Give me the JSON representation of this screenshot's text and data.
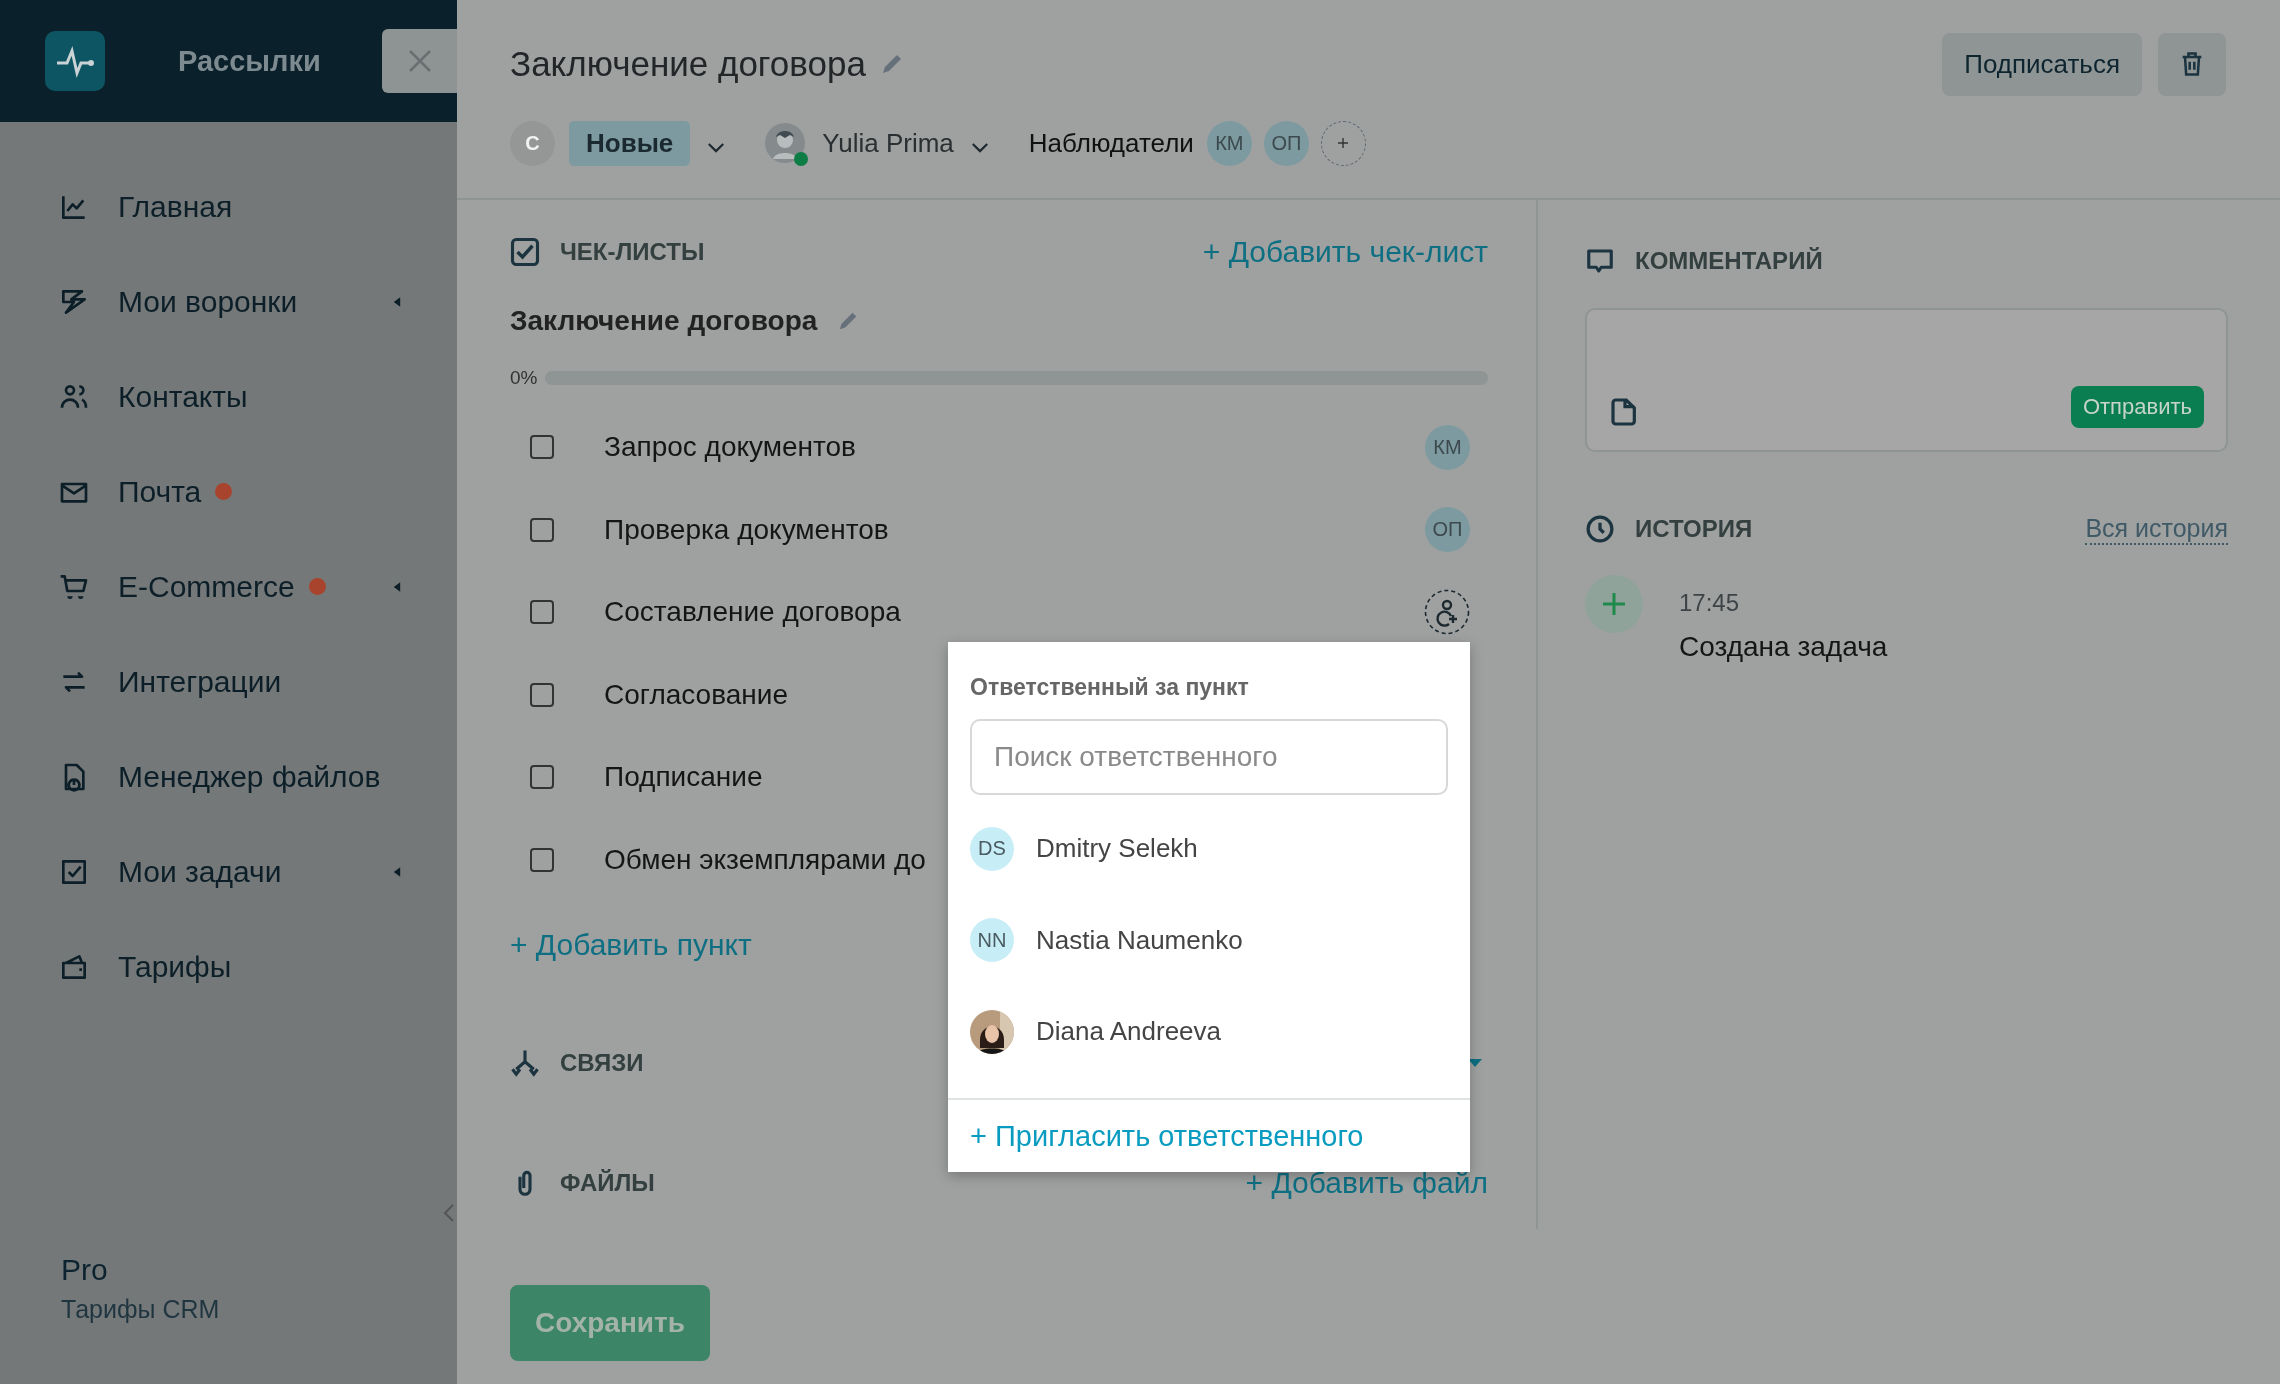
{
  "sidebar": {
    "brand": "Рассылки",
    "items": [
      {
        "label": "Главная",
        "has_badge": false,
        "expandable": false
      },
      {
        "label": "Мои воронки",
        "has_badge": false,
        "expandable": true
      },
      {
        "label": "Контакты",
        "has_badge": false,
        "expandable": false
      },
      {
        "label": "Почта",
        "has_badge": true,
        "expandable": false
      },
      {
        "label": "E-Commerce",
        "has_badge": true,
        "expandable": true
      },
      {
        "label": "Интеграции",
        "has_badge": false,
        "expandable": false
      },
      {
        "label": "Менеджер файлов",
        "has_badge": false,
        "expandable": false
      },
      {
        "label": "Мои задачи",
        "has_badge": false,
        "expandable": true
      },
      {
        "label": "Тарифы",
        "has_badge": false,
        "expandable": false
      }
    ],
    "plan": {
      "name": "Pro",
      "subtitle": "Тарифы CRM"
    }
  },
  "task": {
    "title": "Заключение договора",
    "subscribe": "Подписаться",
    "status": {
      "avatar": "С",
      "label": "Новые"
    },
    "assignee": {
      "name": "Yulia Prima",
      "online": true
    },
    "watchers": {
      "label": "Наблюдатели",
      "avatars": [
        "КМ",
        "ОП"
      ]
    }
  },
  "checklists": {
    "heading": "ЧЕК-ЛИСТЫ",
    "add": "+ Добавить чек-лист",
    "name": "Заключение договора",
    "progress": "0%",
    "level": 0,
    "items": [
      {
        "text": "Запрос документов",
        "checked": false,
        "assignee": "КМ",
        "picker_open": false
      },
      {
        "text": "Проверка документов",
        "checked": false,
        "assignee": "ОП",
        "picker_open": false
      },
      {
        "text": "Составление договора",
        "checked": false,
        "picker_open": true
      },
      {
        "text": "Согласование",
        "checked": false,
        "picker_open": false
      },
      {
        "text": "Подписание",
        "checked": false,
        "picker_open": false
      },
      {
        "text": "Обмен экземплярами до",
        "checked": false,
        "picker_open": false
      }
    ],
    "add_item": "+ Добавить пункт"
  },
  "links": {
    "heading": "СВЯЗИ"
  },
  "files": {
    "heading": "ФАЙЛЫ",
    "add": "+ Добавить файл"
  },
  "save": "Сохранить",
  "comment": {
    "heading": "КОММЕНТАРИЙ",
    "send": "Отправить"
  },
  "history": {
    "heading": "ИСТОРИЯ",
    "all": "Вся история",
    "entries": [
      {
        "time": "17:45",
        "text": "Создана задача"
      }
    ]
  },
  "assignee_popup": {
    "title": "Ответственный за пункт",
    "placeholder": "Поиск ответственного",
    "people": [
      {
        "kind": "initials",
        "initials": "DS",
        "name": "Dmitry Selekh"
      },
      {
        "kind": "initials",
        "initials": "NN",
        "name": "Nastia Naumenko"
      },
      {
        "name": "Diana Andreeva"
      }
    ],
    "invite": "+ Пригласить ответственного"
  }
}
